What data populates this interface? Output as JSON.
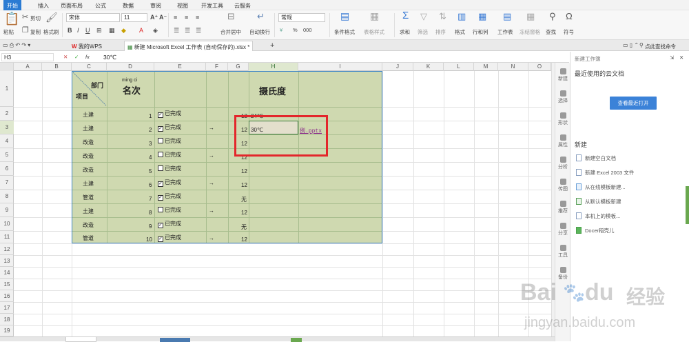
{
  "menu": {
    "items": [
      "开始",
      "插入",
      "页面布局",
      "公式",
      "数据",
      "审阅",
      "视图",
      "开发工具",
      "云服务"
    ]
  },
  "ribbon": {
    "paste": "粘贴",
    "cut": "剪切",
    "copy": "复制",
    "format_painter": "格式刷",
    "font_name": "宋体",
    "font_size": "11",
    "merge_center": "合并居中",
    "wrap_text": "自动换行",
    "number_format": "常规",
    "conditional_format": "条件格式",
    "table_style": "表格样式",
    "sum": "求和",
    "filter": "筛选",
    "sort": "排序",
    "format": "格式",
    "row_col": "行和列",
    "worksheet": "工作表",
    "freeze": "冻结窗格",
    "find": "查找",
    "symbol": "符号",
    "search_cmd": "点此查找命令",
    "percent": "%",
    "thousands": "000"
  },
  "tabs": {
    "wps": "我的WPS",
    "file": "新建 Microsoft Excel 工作表 (自动保存的).xlsx *",
    "add": "+"
  },
  "formula_bar": {
    "cell_ref": "H3",
    "fx": "fx",
    "value": "30℃"
  },
  "sheet": {
    "columns": [
      "A",
      "B",
      "C",
      "D",
      "E",
      "F",
      "G",
      "H",
      "I",
      "J",
      "K",
      "L",
      "M",
      "N",
      "O"
    ],
    "rows": [
      "1",
      "2",
      "3",
      "4",
      "5",
      "6",
      "7",
      "8",
      "9",
      "10",
      "11",
      "12",
      "13",
      "14",
      "15",
      "16",
      "17",
      "18",
      "19"
    ],
    "header_dept": "部门",
    "header_item": "项目",
    "ruby": "ming ci",
    "rank_title": "名次",
    "celsius_title": "摄氏度",
    "c_values": [
      "土建",
      "土建",
      "改造",
      "改造",
      "改造",
      "土建",
      "管道",
      "土建",
      "改造",
      "管道"
    ],
    "d_values": [
      "1",
      "2",
      "3",
      "4",
      "5",
      "6",
      "7",
      "8",
      "9",
      "10"
    ],
    "e_checked": [
      true,
      true,
      false,
      false,
      false,
      true,
      true,
      false,
      true,
      true
    ],
    "e_label": "已完成",
    "f_arrow": "→",
    "g_values": [
      "12",
      "12",
      "12",
      "12",
      "12",
      "12",
      "无",
      "12",
      "无",
      "12"
    ],
    "h2": "24℃",
    "h3": "30℃",
    "link": "例.pptx"
  },
  "sidetools": [
    "新建",
    "选择",
    "形状",
    "属性",
    "分析",
    "传图",
    "推荐",
    "分享",
    "工具",
    "备份"
  ],
  "pane": {
    "title": "新建工作簿",
    "recent_heading": "最近使用的云文档",
    "view_recent": "查看最近打开",
    "new_heading": "新建",
    "items": [
      "新建空白文档",
      "新建 Excel 2003 文件",
      "从在线模板新建...",
      "从默认模板新建",
      "本机上的模板...",
      "Docer稻壳儿"
    ]
  },
  "watermark": {
    "logo": "Bai",
    "logo_du": "du",
    "jingyan": "经验",
    "url": "jingyan.baidu.com"
  },
  "colors": {
    "accent": "#2b7bd3",
    "sheet_fill": "#cfd9b0",
    "highlight": "#e3262b"
  }
}
